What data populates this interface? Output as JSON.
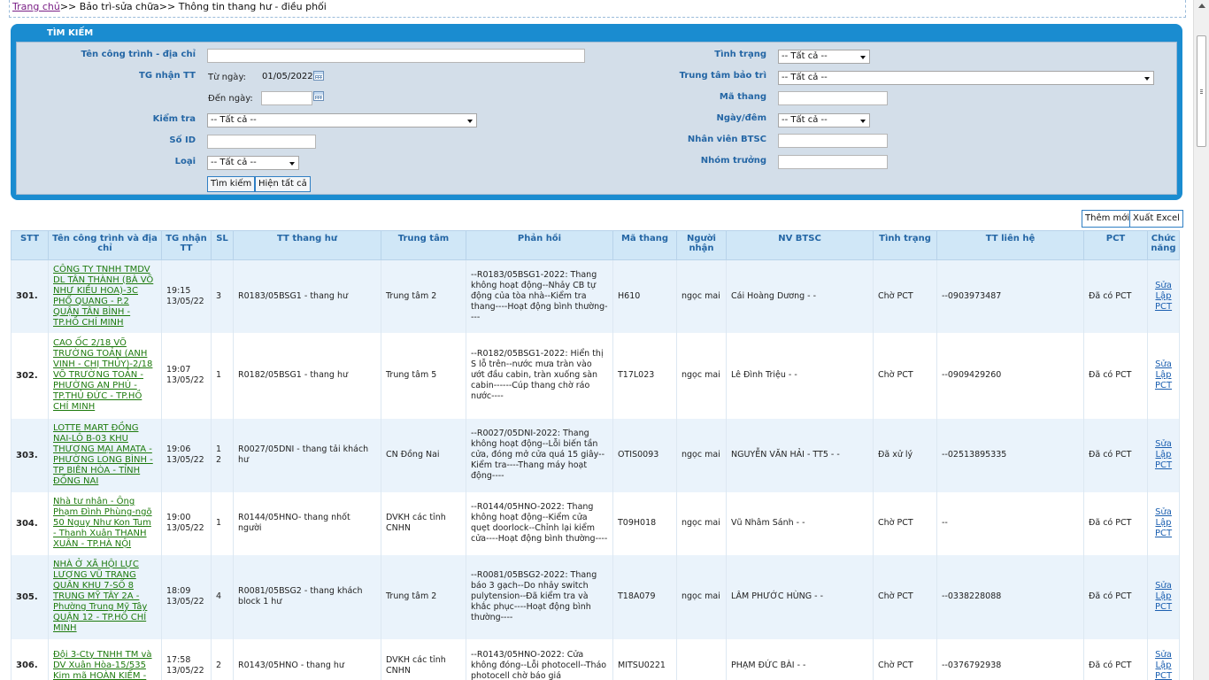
{
  "breadcrumb": {
    "home": "Trang chủ",
    "rest": ">> Bảo trì-sửa chữa>> Thông tin thang hư - điều phối"
  },
  "search": {
    "title": "TÌM KIẾM",
    "labels": {
      "project": "Tên công trình - địa chỉ",
      "received": "TG nhận TT",
      "from": "Từ ngày:",
      "to": "Đến ngày:",
      "check": "Kiểm tra",
      "id": "Số ID",
      "type": "Loại",
      "status": "Tình trạng",
      "center": "Trung tâm bảo trì",
      "code": "Mã thang",
      "daynight": "Ngày/đêm",
      "staff": "Nhân viên BTSC",
      "leader": "Nhóm trưởng"
    },
    "values": {
      "project": "",
      "from": "01/05/2022",
      "to": "",
      "check": "-- Tất cả --",
      "id": "",
      "type": "-- Tất cả --",
      "status": "-- Tất cả --",
      "center": "-- Tất cả --",
      "code": "",
      "daynight": "-- Tất cả --",
      "staff": "",
      "leader": ""
    },
    "buttons": {
      "search": "Tìm kiếm",
      "show_all": "Hiện tất cả"
    }
  },
  "actions": {
    "add": "Thêm mới",
    "export": "Xuất Excel"
  },
  "table": {
    "headers": [
      "STT",
      "Tên công trình và địa chỉ",
      "TG nhận TT",
      "SL",
      "TT thang hư",
      "Trung tâm",
      "Phản hồi",
      "Mã thang",
      "Người nhận",
      "NV BTSC",
      "Tình trạng",
      "TT liên hệ",
      "PCT",
      "Chức năng"
    ],
    "fn_labels": [
      "Sửa",
      "Lập",
      "PCT"
    ],
    "rows": [
      {
        "stt": "301.",
        "name": "CÔNG TY TNHH TMDV DL TÂN THÀNH (BÀ VÕ NHƯ KIỀU HOA)-3C PHỔ QUANG - P.2 QUẬN TÂN BÌNH - TP.HỒ CHÍ MINH",
        "time": "19:15 13/05/22",
        "sl": "3",
        "tt": "R0183/05BSG1 - thang hư",
        "center": "Trung tâm 2",
        "feedback": "--R0183/05BSG1-2022: Thang không hoạt động--Nhảy CB tự động của tòa nhà--Kiểm tra thang----Hoạt động bình thường----",
        "code": "H610",
        "receiver": "ngọc mai",
        "staff": "Cái Hoàng Dương - -",
        "status": "Chờ PCT",
        "contact": "--0903973487",
        "pct": "Đã có PCT"
      },
      {
        "stt": "302.",
        "name": "CAO ỐC 2/18 VÕ TRƯỜNG TOẢN (ANH VINH - CHỊ THỦY)-2/18 VÕ TRƯỜNG TOẢN - PHƯỜNG AN PHÚ - TP.THỦ ĐỨC - TP.HỒ CHÍ MINH",
        "time": "19:07 13/05/22",
        "sl": "1",
        "tt": "R0182/05BSG1 - thang hư",
        "center": "Trung tâm 5",
        "feedback": "--R0182/05BSG1-2022: Hiển thị S lỗ trên--nước mưa tràn vào ướt đầu cabin, tràn xuống sàn cabin------Cúp thang chờ ráo nước----",
        "code": "T17L023",
        "receiver": "ngọc mai",
        "staff": "Lê Đình Triệu - -",
        "status": "Chờ PCT",
        "contact": "--0909429260",
        "pct": "Đã có PCT"
      },
      {
        "stt": "303.",
        "name": "LOTTE MART ĐỒNG NAI-LÔ B-03 KHU THƯƠNG MẠI AMATA - PHƯỜNG LONG BÌNH - TP BIÊN HÒA - TỈNH ĐỒNG NAI",
        "time": "19:06 13/05/22",
        "sl": "1 2",
        "tt": "R0027/05DNI - thang tải khách hư",
        "center": "CN Đồng Nai",
        "feedback": "--R0027/05DNI-2022: Thang không hoạt động--Lỗi biến tần cửa, đóng mở cửa quá 15 giây--Kiểm tra----Thang máy hoạt động----",
        "code": "OTIS0093",
        "receiver": "ngọc mai",
        "staff": "NGUYỄN VĂN HẢI - TT5 - -",
        "status": "Đã xử lý",
        "contact": "--02513895335",
        "pct": "Đã có PCT"
      },
      {
        "stt": "304.",
        "name": "Nhà tư nhân - Ông Phạm Đình Phùng-ngõ 50 Nguy Như Kon Tum - Thanh Xuân THANH XUÂN - TP.HÀ NỘI",
        "time": "19:00 13/05/22",
        "sl": "1",
        "tt": "R0144/05HNO- thang nhốt người",
        "center": "DVKH các tỉnh CNHN",
        "feedback": "--R0144/05HNO-2022: Thang không hoạt động--Kiểm cửa quẹt doorlock--Chỉnh lại kiểm cửa----Hoạt động bình thường----",
        "code": "T09H018",
        "receiver": "ngọc mai",
        "staff": "Vũ Nhâm Sánh - -",
        "status": "Chờ PCT",
        "contact": "--",
        "pct": "Đã có PCT"
      },
      {
        "stt": "305.",
        "name": "NHÀ Ở XÃ HỘI LỰC LƯỢNG VŨ TRANG QUÂN KHU 7-SỐ 8 TRUNG MỸ TÂY 2A - Phường Trung Mỹ Tây QUẬN 12 - TP.HỒ CHÍ MINH",
        "time": "18:09 13/05/22",
        "sl": "4",
        "tt": "R0081/05BSG2 - thang khách block 1 hư",
        "center": "Trung tâm 2",
        "feedback": "--R0081/05BSG2-2022: Thang báo 3 gạch--Do nhảy switch pulytension--Đã kiểm tra và khắc phục----Hoạt động bình thường----",
        "code": "T18A079",
        "receiver": "ngọc mai",
        "staff": "LÂM PHƯỚC HÙNG - -",
        "status": "Chờ PCT",
        "contact": "--0338228088",
        "pct": "Đã có PCT"
      },
      {
        "stt": "306.",
        "name": "Đội 3-Cty TNHH TM và DV Xuân Hòa-15/535 Kim mã HOÀN KIẾM -",
        "time": "17:58 13/05/22",
        "sl": "2",
        "tt": "R0143/05HNO - thang hư",
        "center": "DVKH các tỉnh CNHN",
        "feedback": "--R0143/05HNO-2022: Cửa không đóng--Lỗi photocell--Tháo photocell chờ báo giá",
        "code": "MITSU0221",
        "receiver": "",
        "staff": "PHẠM ĐỨC BÀI - -",
        "status": "Chờ PCT",
        "contact": "--0376792938",
        "pct": "Đã có PCT"
      }
    ]
  }
}
